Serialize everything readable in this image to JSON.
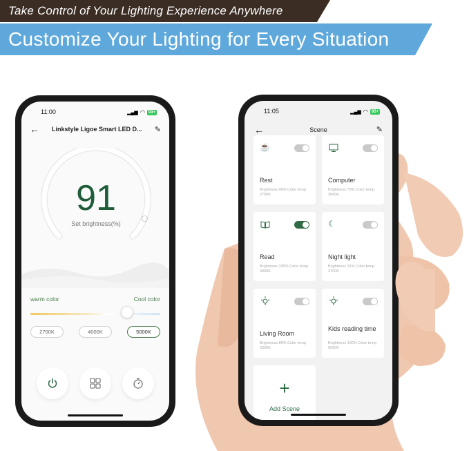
{
  "banners": {
    "top": "Take Control of Your Lighting Experience Anywhere",
    "main": "Customize Your Lighting for Every Situation"
  },
  "phone1": {
    "status": {
      "time": "11:00",
      "battery": "93+"
    },
    "nav": {
      "title": "Linkstyle Ligoe Smart LED D...",
      "back_icon": "arrow-left-icon",
      "edit_icon": "pencil-icon"
    },
    "brightness": {
      "value": "91",
      "label": "Set brightness(%)",
      "percent": 91
    },
    "color_temp": {
      "warm_label": "warm color",
      "cool_label": "Cool color",
      "presets": [
        "2700K",
        "4000K",
        "5000K"
      ],
      "selected": "5000K"
    },
    "actions": [
      {
        "name": "power",
        "icon": "power-icon"
      },
      {
        "name": "scenes",
        "icon": "grid-icon"
      },
      {
        "name": "timer",
        "icon": "timer-icon"
      }
    ]
  },
  "phone2": {
    "status": {
      "time": "11:05",
      "battery": "95+"
    },
    "nav": {
      "title": "Scene",
      "back_icon": "arrow-left-icon",
      "edit_icon": "pencil-icon"
    },
    "scenes": [
      {
        "name": "Rest",
        "meta": "Brightness 40% Color temp 2700K",
        "icon": "coffee-cup-icon",
        "on": false
      },
      {
        "name": "Computer",
        "meta": "Brightness 70% Color temp 3000K",
        "icon": "monitor-icon",
        "on": false
      },
      {
        "name": "Read",
        "meta": "Brightness 100% Color temp 4000K",
        "icon": "book-icon",
        "on": true
      },
      {
        "name": "Night light",
        "meta": "Brightness 15% Color temp 2700K",
        "icon": "moon-icon",
        "on": false
      },
      {
        "name": "Living Room",
        "meta": "Brightness 80% Color temp 3300K",
        "icon": "bulb-icon",
        "on": false
      },
      {
        "name": "Kids reading time",
        "meta": "Brightness 100% Color temp 5000K",
        "icon": "bulb-icon",
        "on": false
      }
    ],
    "add_scene_label": "Add Scene"
  },
  "colors": {
    "accent_green": "#2f6b45",
    "banner_brown": "#3b2d24",
    "banner_blue": "#5ea8db"
  }
}
